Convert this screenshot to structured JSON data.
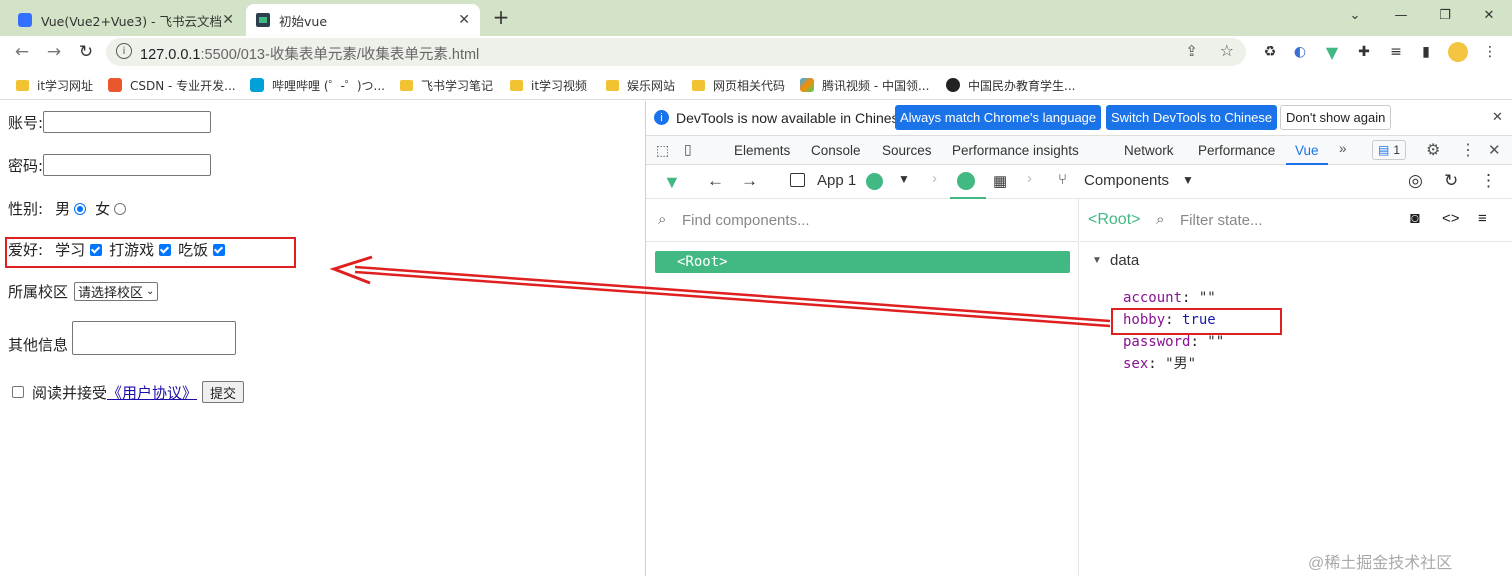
{
  "browser": {
    "tabs": [
      {
        "title": "Vue(Vue2+Vue3) - 飞书云文档",
        "active": false
      },
      {
        "title": "初始vue",
        "active": true
      }
    ],
    "new_tab_label": "+",
    "url_host": "127.0.0.1",
    "url_path": ":5500/013-收集表单元素/收集表单元素.html",
    "bookmarks": [
      "it学习网址",
      "CSDN - 专业开发...",
      "哔哩哔哩 (゜-゜)つ...",
      "飞书学习笔记",
      "it学习视频",
      "娱乐网站",
      "网页相关代码",
      "腾讯视频 - 中国领...",
      "中国民办教育学生..."
    ]
  },
  "form": {
    "account_label": "账号:",
    "password_label": "密码:",
    "gender_label": "性别:",
    "gender_options": [
      "男",
      "女"
    ],
    "hobby_label": "爱好:",
    "hobbies": [
      "学习",
      "打游戏",
      "吃饭"
    ],
    "campus_label": "所属校区",
    "campus_select": "请选择校区",
    "other_label": "其他信息",
    "agree_prefix": "阅读并接受",
    "agree_link": "《用户协议》",
    "submit": "提交"
  },
  "devtools": {
    "infobar_text": "DevTools is now available in Chinese!",
    "btn_match": "Always match Chrome's language",
    "btn_switch": "Switch DevTools to Chinese",
    "btn_dismiss": "Don't show again",
    "tabs": [
      "Elements",
      "Console",
      "Sources",
      "Performance insights",
      "Network",
      "Performance",
      "Vue"
    ],
    "issues_count": "1",
    "vue": {
      "app_label": "App 1",
      "components_label": "Components",
      "find_placeholder": "Find components...",
      "root_node": "<Root>",
      "selected_label": "<Root>",
      "filter_placeholder": "Filter state...",
      "section": "data",
      "state": [
        {
          "key": "account",
          "value": "\"\""
        },
        {
          "key": "hobby",
          "value": "true"
        },
        {
          "key": "password",
          "value": "\"\""
        },
        {
          "key": "sex",
          "value": "\"男\""
        }
      ]
    }
  },
  "watermark": "@稀土掘金技术社区",
  "colors": {
    "annotation": "#e02020",
    "vue_green": "#42b883",
    "chrome_blue": "#1a73e8"
  }
}
